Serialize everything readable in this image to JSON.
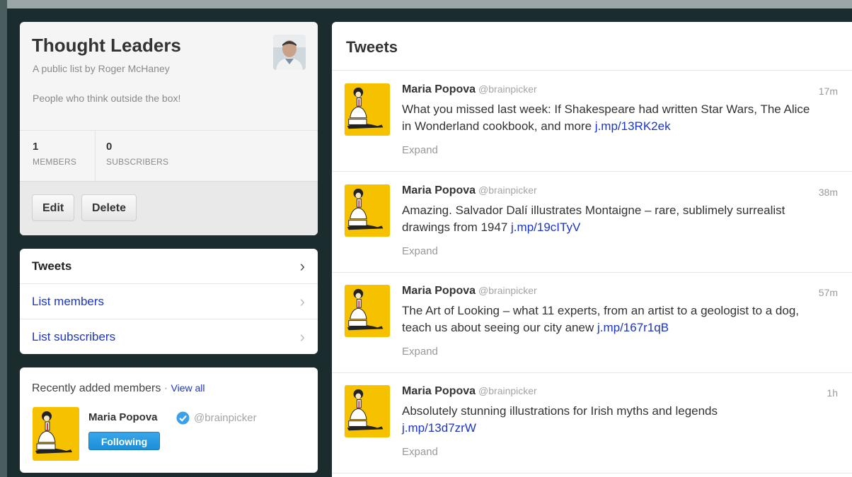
{
  "list": {
    "title": "Thought Leaders",
    "byline": "A public list by Roger McHaney",
    "description": "People who think outside the box!",
    "members_count": "1",
    "members_label": "MEMBERS",
    "subscribers_count": "0",
    "subscribers_label": "SUBSCRIBERS",
    "edit_label": "Edit",
    "delete_label": "Delete"
  },
  "nav": {
    "items": [
      {
        "label": "Tweets",
        "active": true
      },
      {
        "label": "List members",
        "active": false
      },
      {
        "label": "List subscribers",
        "active": false
      }
    ],
    "chevron": "›"
  },
  "recent": {
    "heading": "Recently added members",
    "separator": " · ",
    "view_all": "View all",
    "member_name": "Maria Popova",
    "member_handle": "@brainpicker",
    "follow_label": "Following"
  },
  "tweets": {
    "title": "Tweets",
    "items": [
      {
        "name": "Maria Popova",
        "handle": "@brainpicker",
        "time": "17m",
        "text": "What you missed last week: If Shakespeare had written Star Wars, The Alice in Wonderland cookbook, and more ",
        "link": "j.mp/13RK2ek",
        "expand": "Expand"
      },
      {
        "name": "Maria Popova",
        "handle": "@brainpicker",
        "time": "38m",
        "text": "Amazing. Salvador Dalí illustrates Montaigne – rare, sublimely surrealist drawings from 1947 ",
        "link": "j.mp/19cITyV",
        "expand": "Expand"
      },
      {
        "name": "Maria Popova",
        "handle": "@brainpicker",
        "time": "57m",
        "text": "The Art of Looking – what 11 experts, from an artist to a geologist to a dog, teach us about seeing our city anew ",
        "link": "j.mp/167r1qB",
        "expand": "Expand"
      },
      {
        "name": "Maria Popova",
        "handle": "@brainpicker",
        "time": "1h",
        "text": "Absolutely stunning illustrations for Irish myths and legends ",
        "link": "j.mp/13d7zrW",
        "expand": "Expand"
      }
    ]
  },
  "colors": {
    "link": "#1b35c6",
    "follow_button": "#1b8fd8",
    "avatar_yellow": "#f6c200",
    "background": "#1b2c2e"
  }
}
